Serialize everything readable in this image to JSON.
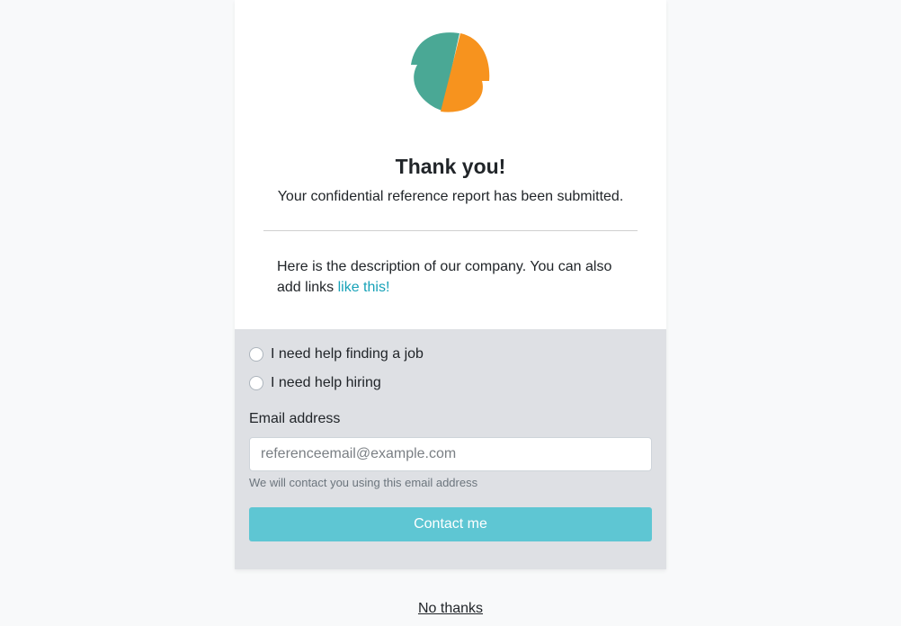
{
  "logo": {
    "icon": "company-logo",
    "colors": {
      "left": "#4aa895",
      "right": "#f7931e"
    }
  },
  "confirmation": {
    "title": "Thank you!",
    "subtitle": "Your confidential reference report has been submitted."
  },
  "company": {
    "description_text": "Here is the description of our company. You can also add links ",
    "link_text": "like this!"
  },
  "contact_form": {
    "options": [
      {
        "label": "I need help finding a job",
        "selected": false
      },
      {
        "label": "I need help hiring",
        "selected": false
      }
    ],
    "email_label": "Email address",
    "email_value": "",
    "email_placeholder": "referenceemail@example.com",
    "email_help": "We will contact you using this email address",
    "submit_label": "Contact me"
  },
  "footer": {
    "no_thanks_label": "No thanks"
  },
  "colors": {
    "page_background": "#f8f9fa",
    "panel_background": "#dee0e4",
    "button": "#5ec6d3",
    "link": "#17a2b8"
  }
}
